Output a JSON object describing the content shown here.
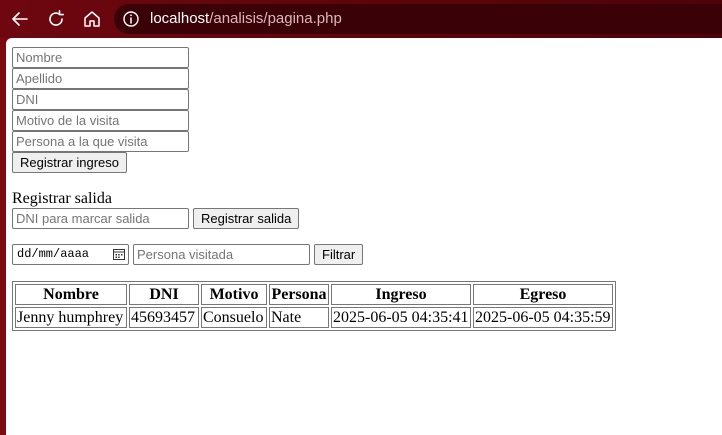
{
  "browser": {
    "url_host": "localhost",
    "url_path": "/analisis/pagina.php"
  },
  "ingreso_form": {
    "nombre_placeholder": "Nombre",
    "apellido_placeholder": "Apellido",
    "dni_placeholder": "DNI",
    "motivo_placeholder": "Motivo de la visita",
    "persona_placeholder": "Persona a la que visita",
    "submit_label": "Registrar ingreso"
  },
  "salida_form": {
    "title": "Registrar salida",
    "dni_placeholder": "DNI para marcar salida",
    "submit_label": "Registrar salida"
  },
  "filter": {
    "date_placeholder": "dd/mm/aaaa",
    "persona_placeholder": "Persona visitada",
    "submit_label": "Filtrar"
  },
  "table": {
    "headers": [
      "Nombre",
      "DNI",
      "Motivo",
      "Persona",
      "Ingreso",
      "Egreso"
    ],
    "rows": [
      [
        "Jenny humphrey",
        "45693457",
        "Consuelo",
        "Nate",
        "2025-06-05 04:35:41",
        "2025-06-05 04:35:59"
      ]
    ]
  },
  "colors": {
    "frame": "#6e0710",
    "urlbar": "#3a0206"
  }
}
